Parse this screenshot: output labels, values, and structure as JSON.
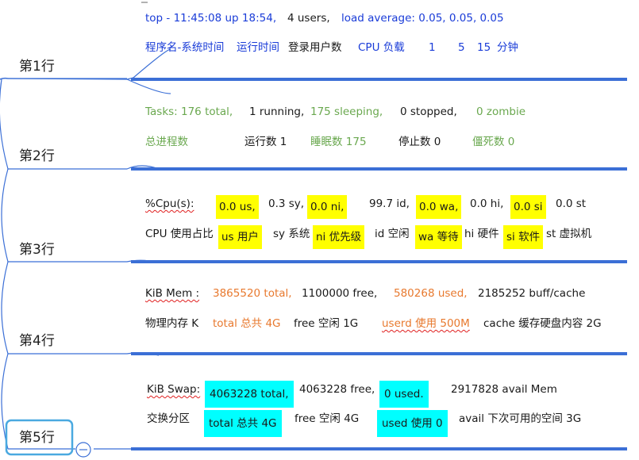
{
  "rows": [
    {
      "label": "第1行"
    },
    {
      "label": "第2行"
    },
    {
      "label": "第3行"
    },
    {
      "label": "第4行"
    },
    {
      "label": "第5行"
    }
  ],
  "row1": {
    "top": "top - 11:45:08 up 18:54,",
    "users": "4 users,",
    "load": "load average: 0.05, 0.05, 0.05",
    "a_prog": "程序名-系统时间",
    "a_uptime": "运行时间",
    "a_users": "登录用户数",
    "a_cpu": "CPU 负载",
    "a_1": "1",
    "a_5": "5",
    "a_15": "15",
    "a_min": "分钟"
  },
  "row2": {
    "tasks": "Tasks: 176 total,",
    "running": "1 running,",
    "sleeping": "175 sleeping,",
    "stopped": "0 stopped,",
    "zombie": "0 zombie",
    "a_total": "总进程数",
    "a_running": "运行数 1",
    "a_sleeping": "睡眠数 175",
    "a_stopped": "停止数 0",
    "a_zombie": "僵死数 0"
  },
  "row3": {
    "cpu_prefix": "%Cpu(s):",
    "us": "0.0 us,",
    "sy": "0.3 sy,",
    "ni": "0.0 ni,",
    "id": "99.7 id,",
    "wa": "0.0 wa,",
    "hi": "0.0 hi,",
    "si": "0.0 si",
    "st": "0.0 st",
    "a_cpu": "CPU 使用占比",
    "a_us": "us 用户",
    "a_sy": "sy 系统",
    "a_ni": "ni 优先级",
    "a_id": "id 空闲",
    "a_wa": "wa 等待",
    "a_hi": "hi 硬件",
    "a_si": "si 软件",
    "a_st": "st 虚拟机"
  },
  "row4": {
    "mem_prefix": "KiB Mem :",
    "total": "3865520 total,",
    "free": "1100000 free,",
    "used": "580268 used,",
    "cache": "2185252 buff/cache",
    "a_phys": "物理内存 K",
    "a_total": "total 总共 4G",
    "a_free": "free 空闲 1G",
    "a_used": "userd 使用 500M",
    "a_cache": "cache 缓存硬盘内容 2G"
  },
  "row5": {
    "swap_prefix": "KiB Swap:",
    "total": "4063228 total,",
    "free": "4063228 free,",
    "used": "0 used.",
    "avail": "2917828 avail Mem",
    "a_swap": "交换分区",
    "a_total": "total 总共 4G",
    "a_free": "free 空闲 4G",
    "a_used": "used 使用 0",
    "a_avail": "avail 下次可用的空间 3G"
  },
  "colors": {
    "line_blue": "#3b6fd6",
    "header_blue": "#1a3cd8",
    "tasks_green": "#6aa84f",
    "mem_orange": "#e8792e",
    "highlight_yellow": "#ffff00",
    "highlight_cyan": "#00ffff",
    "selection_border": "#4aa9e0"
  },
  "icons": [
    "collapse-circle-icon"
  ]
}
